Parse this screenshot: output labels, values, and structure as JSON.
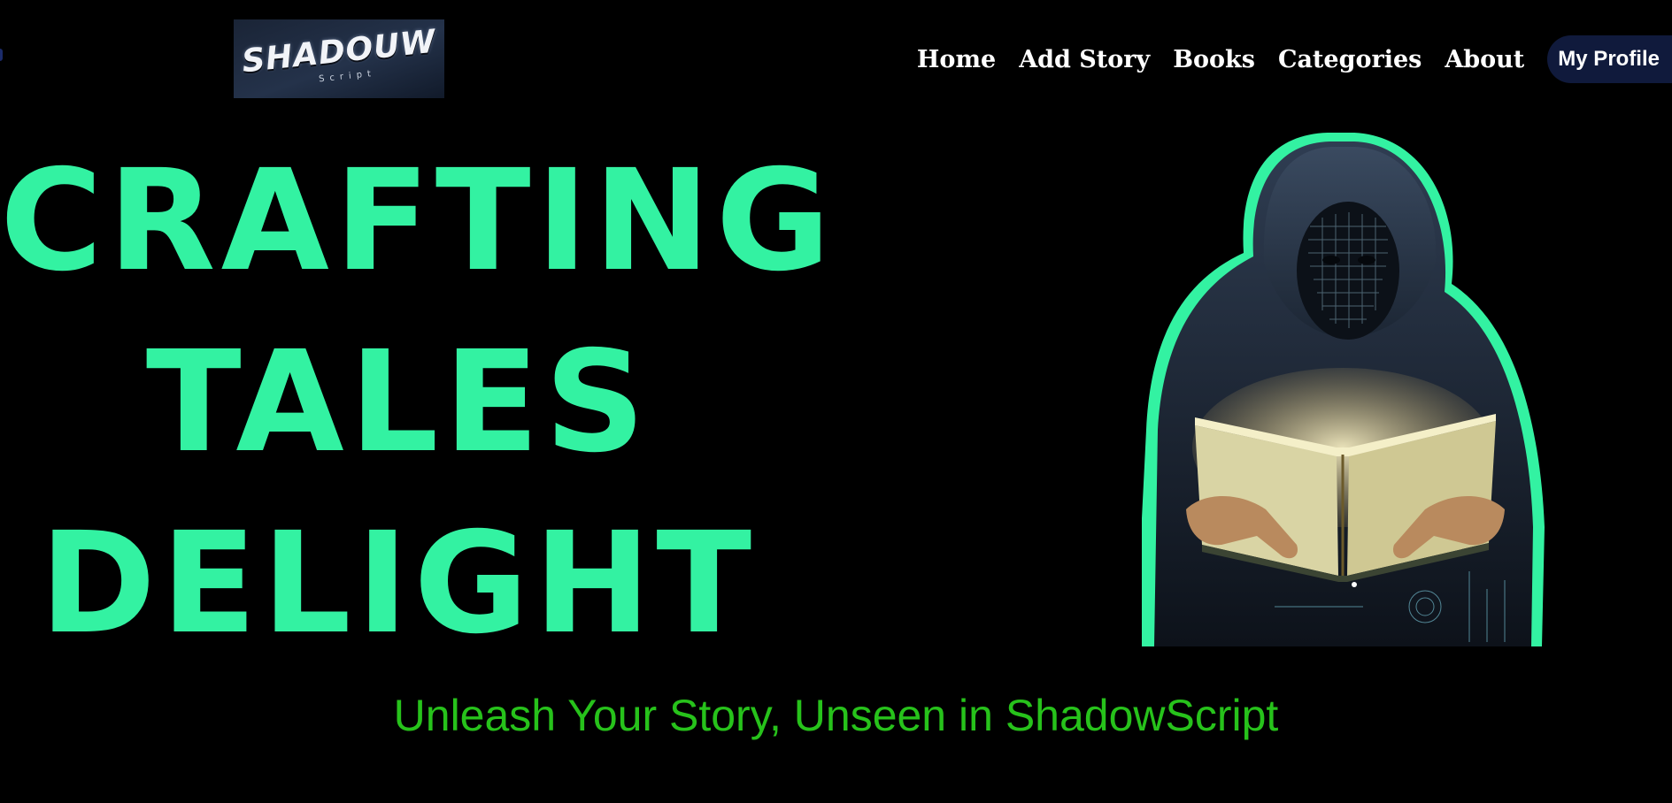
{
  "brand": {
    "logo_text": "SHADOUW",
    "logo_subtext": "Script"
  },
  "nav": {
    "items": [
      {
        "label": "Home"
      },
      {
        "label": "Add Story"
      },
      {
        "label": "Books"
      },
      {
        "label": "Categories"
      },
      {
        "label": "About"
      }
    ],
    "profile_label": "My Profile"
  },
  "hero": {
    "lines": [
      "CRAFTING",
      "TALES",
      "DELIGHT"
    ]
  },
  "tagline": "Unleash Your Story, Unseen in ShadowScript",
  "colors": {
    "background": "#000000",
    "headline": "#33f2a2",
    "tagline": "#27c21b",
    "profile_button": "#101a3c",
    "glow": "#33f2a2"
  },
  "illustration": {
    "icon": "hooded-reader-icon"
  }
}
